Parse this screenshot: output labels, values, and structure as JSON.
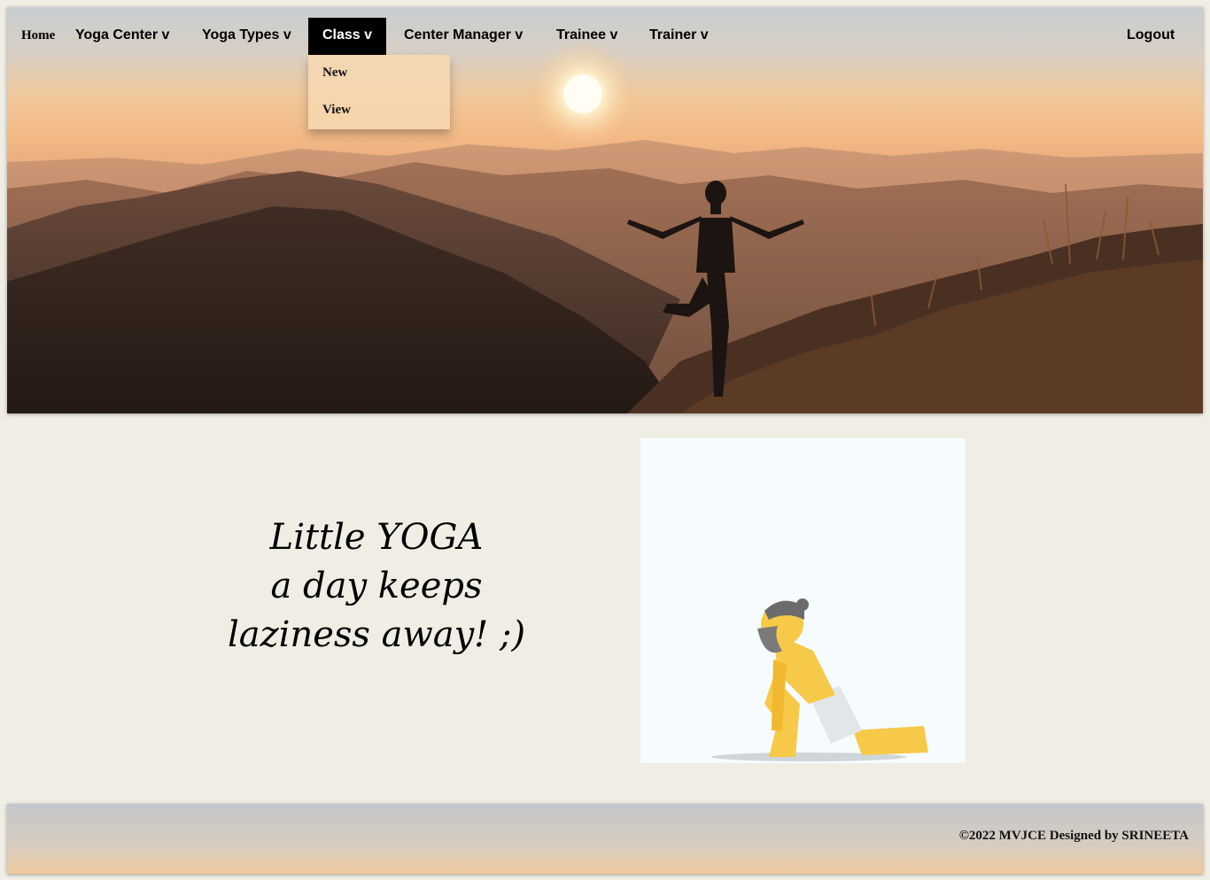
{
  "nav": {
    "home": "Home",
    "yoga_center": "Yoga Center v",
    "yoga_types": "Yoga Types v",
    "class": "Class v",
    "center_manager": "Center Manager v",
    "trainee": "Trainee v",
    "trainer": "Trainer v",
    "logout": "Logout"
  },
  "class_menu": {
    "items": [
      "New",
      "View"
    ]
  },
  "quote": {
    "line1": "Little YOGA",
    "line2": "a day keeps",
    "line3": "laziness away! ;)"
  },
  "footer": {
    "text": "©2022 MVJCE Designed by SRINEETA"
  },
  "colors": {
    "page_bg": "#f0ede5",
    "nav_active_bg": "#000000",
    "dropdown_bg": "#f7d8b2"
  }
}
